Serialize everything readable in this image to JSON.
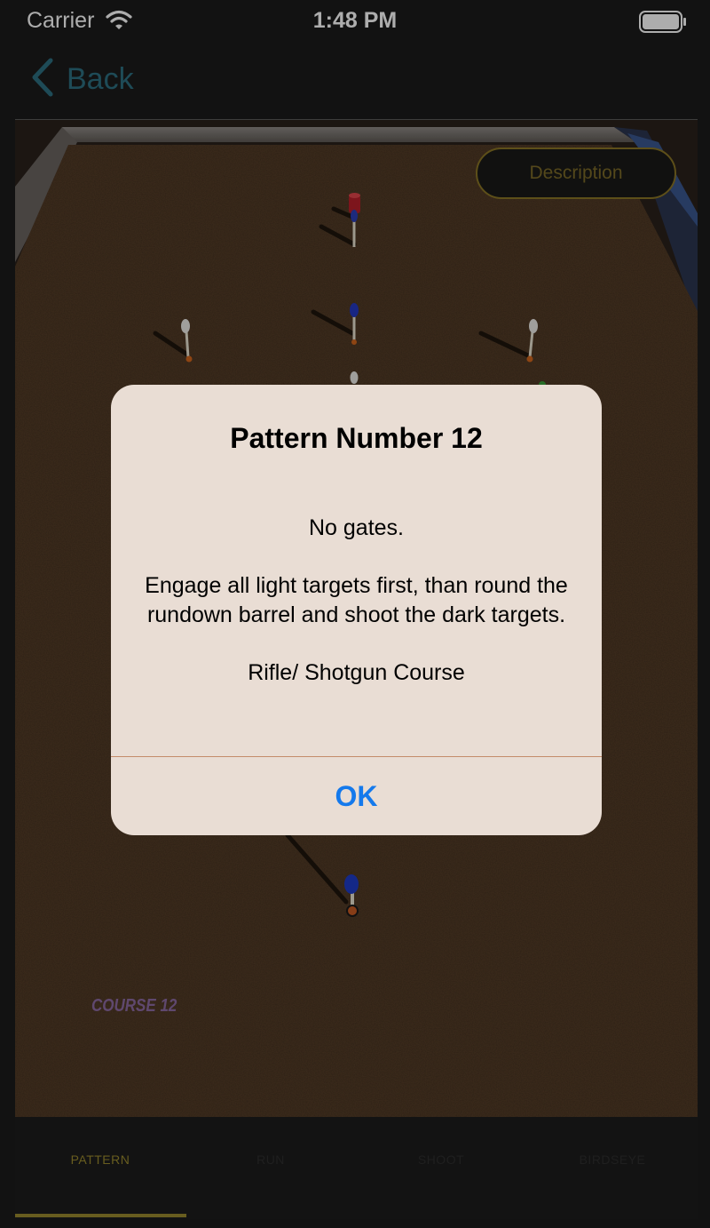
{
  "status_bar": {
    "carrier": "Carrier",
    "time": "1:48 PM"
  },
  "nav": {
    "back_label": "Back"
  },
  "scene": {
    "course_label": "COURSE 12"
  },
  "description_button": {
    "label": "Description"
  },
  "alert": {
    "title": "Pattern Number 12",
    "message": "No gates.\n\nEngage all light targets first, than round the rundown barrel and shoot the dark targets.\n\nRifle/ Shotgun Course",
    "ok_label": "OK"
  },
  "tabs": {
    "items": [
      {
        "label": "PATTERN",
        "active": true
      },
      {
        "label": "RUN",
        "active": false
      },
      {
        "label": "SHOOT",
        "active": false
      },
      {
        "label": "BIRDSEYE",
        "active": false
      }
    ],
    "active_color": "#9a8a2e",
    "inactive_color": "#2f2f2f"
  },
  "colors": {
    "back_accent": "#2d6f80",
    "ok_blue": "#1479ec",
    "gold_outline": "#8a7526"
  }
}
